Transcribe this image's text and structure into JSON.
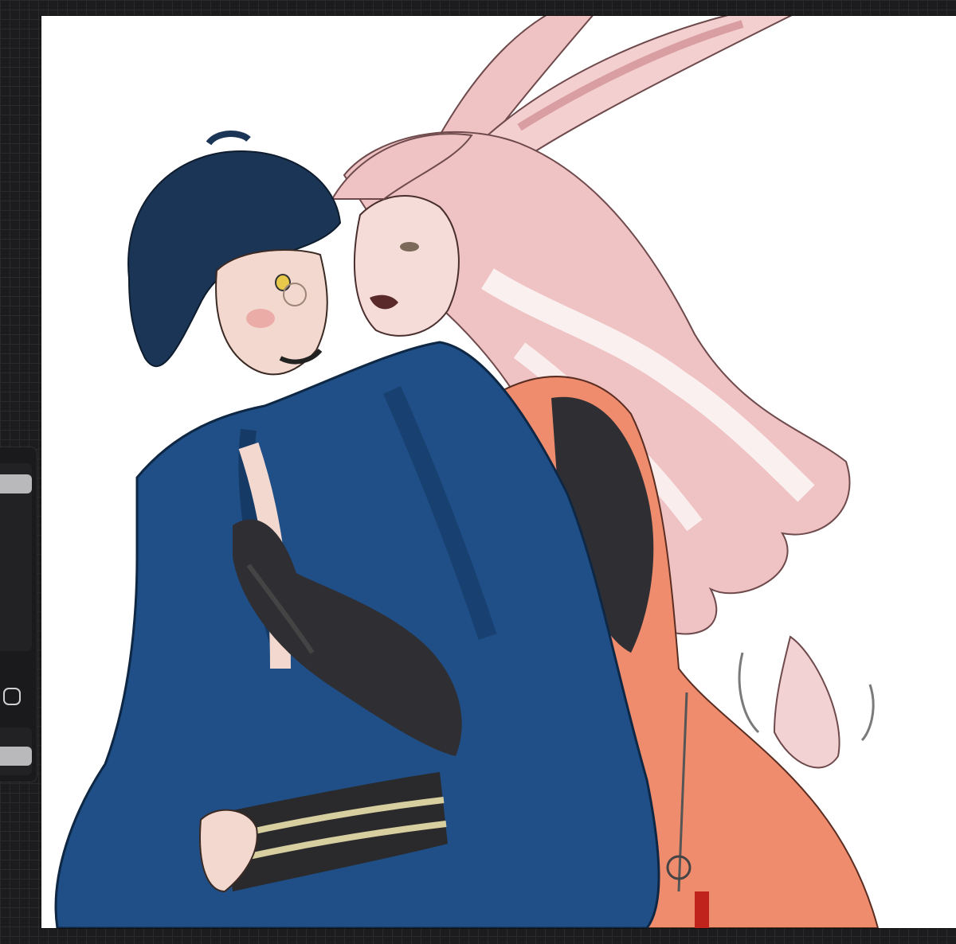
{
  "app": {
    "accent_color": "#b9b9bb",
    "canvas_background": "#ffffff",
    "workspace_background": "#1c1c1e"
  },
  "sidebar": {
    "brush_size_slider": {
      "icon": "slider-thumb"
    },
    "modify_button": {
      "icon": "rounded-square-icon"
    },
    "brush_opacity_slider": {
      "icon": "slider-thumb"
    }
  },
  "canvas": {
    "artwork": "illustration",
    "palette": {
      "kimono_blue": "#1f4f86",
      "hair_dark": "#1b3556",
      "skin": "#f3d8cf",
      "rabbit_hair": "#efc2c3",
      "dress_orange": "#ef8c6d",
      "sleeve_dark": "#2f2f33",
      "sash_stripe": "#d8cfa0"
    }
  }
}
